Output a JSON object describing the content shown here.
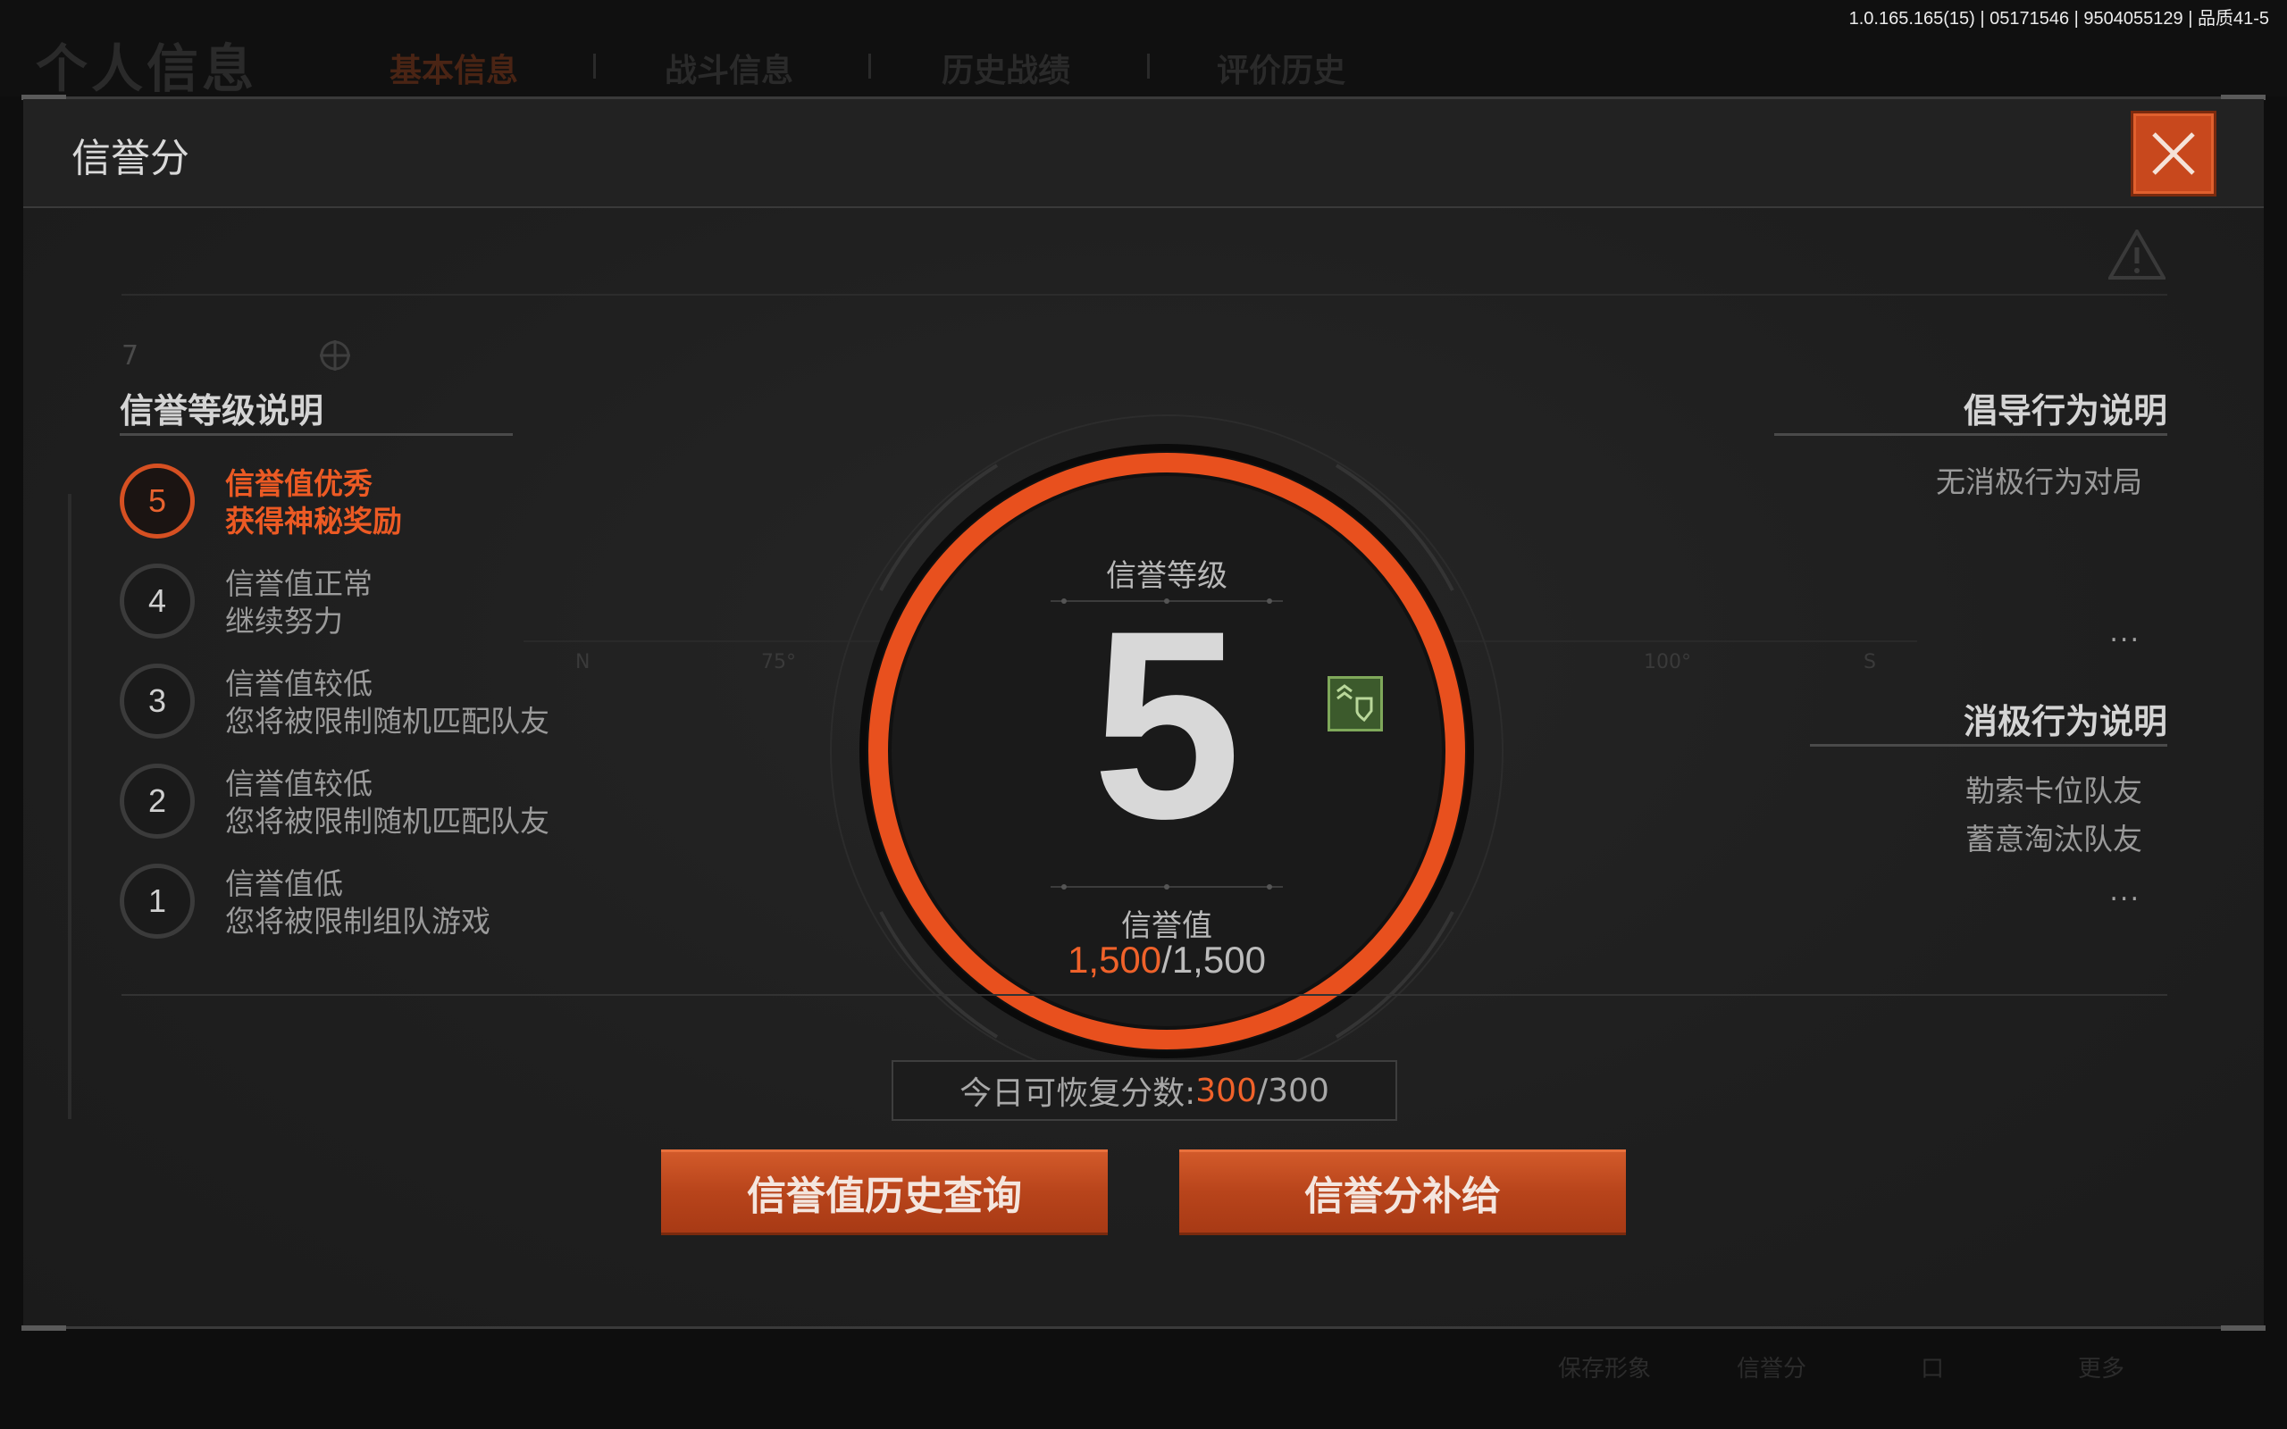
{
  "status_bar": {
    "version": "1.0.165.165(15) | 05171546 | 9504055129 | 品质41-5"
  },
  "background": {
    "page_title": "个人信息",
    "tabs": [
      "基本信息",
      "战斗信息",
      "历史战绩",
      "评价历史"
    ],
    "bottom_items": [
      "保存形象",
      "信誉分",
      "口",
      "更多"
    ]
  },
  "modal": {
    "title": "信誉分",
    "close_label": "✕"
  },
  "levels_section": {
    "title": "信誉等级说明",
    "items": [
      {
        "num": "5",
        "line1": "信誉值优秀",
        "line2": "获得神秘奖励",
        "active": true
      },
      {
        "num": "4",
        "line1": "信誉值正常",
        "line2": "继续努力",
        "active": false
      },
      {
        "num": "3",
        "line1": "信誉值较低",
        "line2": "您将被限制随机匹配队友",
        "active": false
      },
      {
        "num": "2",
        "line1": "信誉值较低",
        "line2": "您将被限制随机匹配队友",
        "active": false
      },
      {
        "num": "1",
        "line1": "信誉值低",
        "line2": "您将被限制组队游戏",
        "active": false
      }
    ]
  },
  "gauge": {
    "level_title": "信誉等级",
    "level_value": "5",
    "score_title": "信誉值",
    "score_current": "1,500",
    "score_max": "/1,500",
    "accent": "#e8501e",
    "compass_marks": [
      "N",
      "75°",
      "100°",
      "S"
    ],
    "hud_number": "7"
  },
  "encourage_section": {
    "title": "倡导行为说明",
    "items": [
      "无消极行为对局"
    ],
    "more": "..."
  },
  "negative_section": {
    "title": "消极行为说明",
    "items": [
      "勒索卡位队友",
      "蓄意淘汰队友"
    ],
    "more": "..."
  },
  "recovery": {
    "label": "今日可恢复分数:",
    "current": "300",
    "max": "/300"
  },
  "buttons": {
    "history": "信誉值历史查询",
    "supply": "信誉分补给"
  },
  "colors": {
    "accent": "#e8501e",
    "button": "#c04a1e",
    "badge": "#3c5a2c"
  }
}
